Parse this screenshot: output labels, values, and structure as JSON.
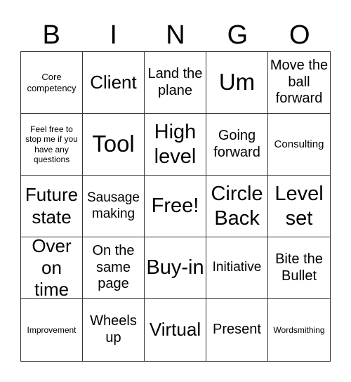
{
  "header": {
    "letters": [
      "B",
      "I",
      "N",
      "G",
      "O"
    ]
  },
  "cells": [
    {
      "text": "Core competency",
      "size": "s-sm"
    },
    {
      "text": "Client",
      "size": "s-2xl"
    },
    {
      "text": "Land the plane",
      "size": "s-xl"
    },
    {
      "text": "Um",
      "size": "s-4xl"
    },
    {
      "text": "Move the ball forward",
      "size": "s-xl"
    },
    {
      "text": "Feel free to stop me if you have any questions",
      "size": "s-xs"
    },
    {
      "text": "Tool",
      "size": "s-4xl"
    },
    {
      "text": "High level",
      "size": "s-3xl"
    },
    {
      "text": "Going forward",
      "size": "s-xl"
    },
    {
      "text": "Consulting",
      "size": "s-md"
    },
    {
      "text": "Future state",
      "size": "s-2xl"
    },
    {
      "text": "Sausage making",
      "size": "s-lg"
    },
    {
      "text": "Free!",
      "size": "s-3xl"
    },
    {
      "text": "Circle Back",
      "size": "s-3xl"
    },
    {
      "text": "Level set",
      "size": "s-3xl"
    },
    {
      "text": "Over on time",
      "size": "s-2xl"
    },
    {
      "text": "On the same page",
      "size": "s-xl"
    },
    {
      "text": "Buy-in",
      "size": "s-3xl"
    },
    {
      "text": "Initiative",
      "size": "s-lg"
    },
    {
      "text": "Bite the Bullet",
      "size": "s-xl"
    },
    {
      "text": "Improvement",
      "size": "s-xs"
    },
    {
      "text": "Wheels up",
      "size": "s-xl"
    },
    {
      "text": "Virtual",
      "size": "s-2xl"
    },
    {
      "text": "Present",
      "size": "s-xl"
    },
    {
      "text": "Wordsmithing",
      "size": "s-xs"
    }
  ]
}
